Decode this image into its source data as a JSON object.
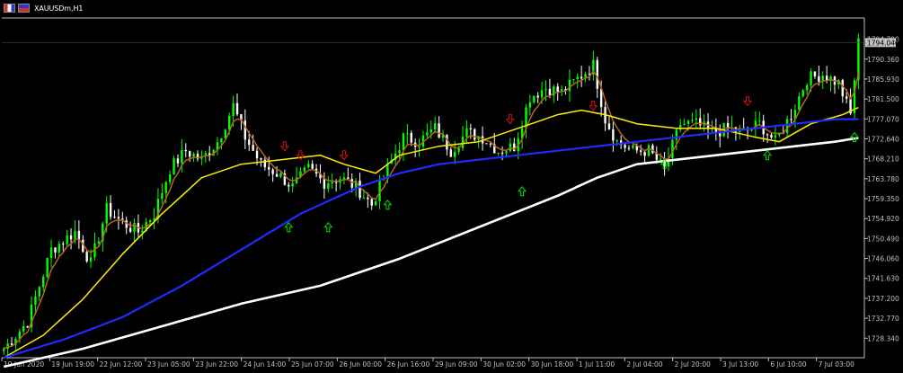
{
  "window": {
    "symbol_label": "XAUUSDm,H1",
    "current_price": "1794.040",
    "colors": {
      "background": "#000000",
      "axis": "#c0c0c0",
      "candle_bull": "#00ff00",
      "candle_bear": "#ffffff",
      "ma_fast": "#b5651d",
      "ma_mid": "#ffee00",
      "ma_slow": "#1f2bff",
      "ma_long": "#ffffff",
      "arrow_up": "#00e000",
      "arrow_down": "#e01010",
      "price_tag_bg": "#c0c0c0"
    }
  },
  "chart_data": {
    "type": "candlestick",
    "symbol": "XAUUSDm",
    "timeframe": "H1",
    "ylim": [
      1724.0,
      1799.5
    ],
    "y_ticks": [
      "1794.790",
      "1790.360",
      "1785.930",
      "1781.500",
      "1777.070",
      "1772.640",
      "1768.210",
      "1763.780",
      "1759.350",
      "1754.920",
      "1750.490",
      "1746.060",
      "1741.630",
      "1737.200",
      "1732.770",
      "1728.340"
    ],
    "x_ticks": [
      "19 Jun 2020",
      "19 Jun 19:00",
      "22 Jun 12:00",
      "23 Jun 05:00",
      "23 Jun 22:00",
      "24 Jun 14:00",
      "25 Jun 07:00",
      "26 Jun 00:00",
      "26 Jun 16:00",
      "29 Jun 09:00",
      "30 Jun 02:00",
      "30 Jun 18:00",
      "1 Jul 11:00",
      "2 Jul 04:00",
      "2 Jul 20:00",
      "3 Jul 13:00",
      "6 Jul 10:00",
      "7 Jul 03:00"
    ],
    "close_path": [
      [
        0,
        1726
      ],
      [
        6,
        1732
      ],
      [
        12,
        1748
      ],
      [
        18,
        1752
      ],
      [
        22,
        1745
      ],
      [
        26,
        1757
      ],
      [
        30,
        1754
      ],
      [
        34,
        1752
      ],
      [
        38,
        1756
      ],
      [
        42,
        1766
      ],
      [
        46,
        1770
      ],
      [
        50,
        1768
      ],
      [
        54,
        1772
      ],
      [
        58,
        1780
      ],
      [
        61,
        1773
      ],
      [
        65,
        1767
      ],
      [
        69,
        1765
      ],
      [
        73,
        1762
      ],
      [
        77,
        1766
      ],
      [
        81,
        1763
      ],
      [
        85,
        1764
      ],
      [
        89,
        1762
      ],
      [
        93,
        1758
      ],
      [
        97,
        1766
      ],
      [
        101,
        1773
      ],
      [
        105,
        1772
      ],
      [
        109,
        1775
      ],
      [
        113,
        1770
      ],
      [
        117,
        1774
      ],
      [
        121,
        1773
      ],
      [
        125,
        1770
      ],
      [
        129,
        1771
      ],
      [
        133,
        1782
      ],
      [
        137,
        1784
      ],
      [
        141,
        1783
      ],
      [
        145,
        1786
      ],
      [
        149,
        1789
      ],
      [
        152,
        1777
      ],
      [
        155,
        1772
      ],
      [
        159,
        1770
      ],
      [
        163,
        1770
      ],
      [
        167,
        1766
      ],
      [
        171,
        1776
      ],
      [
        175,
        1776
      ],
      [
        179,
        1774
      ],
      [
        183,
        1775
      ],
      [
        187,
        1774
      ],
      [
        191,
        1776
      ],
      [
        195,
        1772
      ],
      [
        199,
        1778
      ],
      [
        203,
        1786
      ],
      [
        207,
        1787
      ],
      [
        211,
        1785
      ],
      [
        214,
        1778
      ],
      [
        216,
        1794
      ]
    ],
    "ma_series": [
      {
        "name": "",
        "values": [
          [
            0,
            1724
          ],
          [
            10,
            1729
          ],
          [
            20,
            1737
          ],
          [
            30,
            1747
          ],
          [
            40,
            1756
          ],
          [
            50,
            1764
          ],
          [
            60,
            1767
          ],
          [
            70,
            1768
          ],
          [
            80,
            1769
          ],
          [
            86,
            1767
          ],
          [
            94,
            1765
          ],
          [
            100,
            1769
          ],
          [
            110,
            1771
          ],
          [
            120,
            1772
          ],
          [
            130,
            1775
          ],
          [
            140,
            1778
          ],
          [
            146,
            1779
          ],
          [
            152,
            1778
          ],
          [
            160,
            1776
          ],
          [
            170,
            1775
          ],
          [
            180,
            1775
          ],
          [
            190,
            1773
          ],
          [
            196,
            1772
          ],
          [
            204,
            1776
          ],
          [
            212,
            1778
          ],
          [
            217,
            1780
          ]
        ]
      },
      {
        "name": "",
        "values": [
          [
            0,
            1724
          ],
          [
            15,
            1728
          ],
          [
            30,
            1733
          ],
          [
            45,
            1740
          ],
          [
            60,
            1748
          ],
          [
            75,
            1756
          ],
          [
            90,
            1762
          ],
          [
            100,
            1765
          ],
          [
            110,
            1767
          ],
          [
            120,
            1768
          ],
          [
            130,
            1769
          ],
          [
            140,
            1770
          ],
          [
            150,
            1771
          ],
          [
            160,
            1772
          ],
          [
            170,
            1773
          ],
          [
            180,
            1774
          ],
          [
            190,
            1775
          ],
          [
            200,
            1776
          ],
          [
            210,
            1777
          ],
          [
            217,
            1777
          ]
        ]
      },
      {
        "name": "",
        "values": [
          [
            0,
            1722
          ],
          [
            20,
            1726
          ],
          [
            40,
            1731
          ],
          [
            60,
            1736
          ],
          [
            80,
            1740
          ],
          [
            100,
            1746
          ],
          [
            120,
            1753
          ],
          [
            140,
            1760
          ],
          [
            150,
            1764
          ],
          [
            160,
            1767
          ],
          [
            170,
            1768
          ],
          [
            180,
            1769
          ],
          [
            190,
            1770
          ],
          [
            200,
            1771
          ],
          [
            210,
            1772
          ],
          [
            217,
            1773
          ]
        ]
      }
    ],
    "signals": [
      {
        "x": 71,
        "dir": "down",
        "price": 1771
      },
      {
        "x": 75,
        "dir": "down",
        "price": 1769
      },
      {
        "x": 86,
        "dir": "down",
        "price": 1769
      },
      {
        "x": 128,
        "dir": "down",
        "price": 1777
      },
      {
        "x": 149,
        "dir": "down",
        "price": 1780
      },
      {
        "x": 188,
        "dir": "down",
        "price": 1781
      },
      {
        "x": 72,
        "dir": "up",
        "price": 1753
      },
      {
        "x": 82,
        "dir": "up",
        "price": 1753
      },
      {
        "x": 97,
        "dir": "up",
        "price": 1758
      },
      {
        "x": 131,
        "dir": "up",
        "price": 1761
      },
      {
        "x": 167,
        "dir": "up",
        "price": 1767
      },
      {
        "x": 193,
        "dir": "up",
        "price": 1769
      },
      {
        "x": 215,
        "dir": "up",
        "price": 1773
      }
    ]
  }
}
